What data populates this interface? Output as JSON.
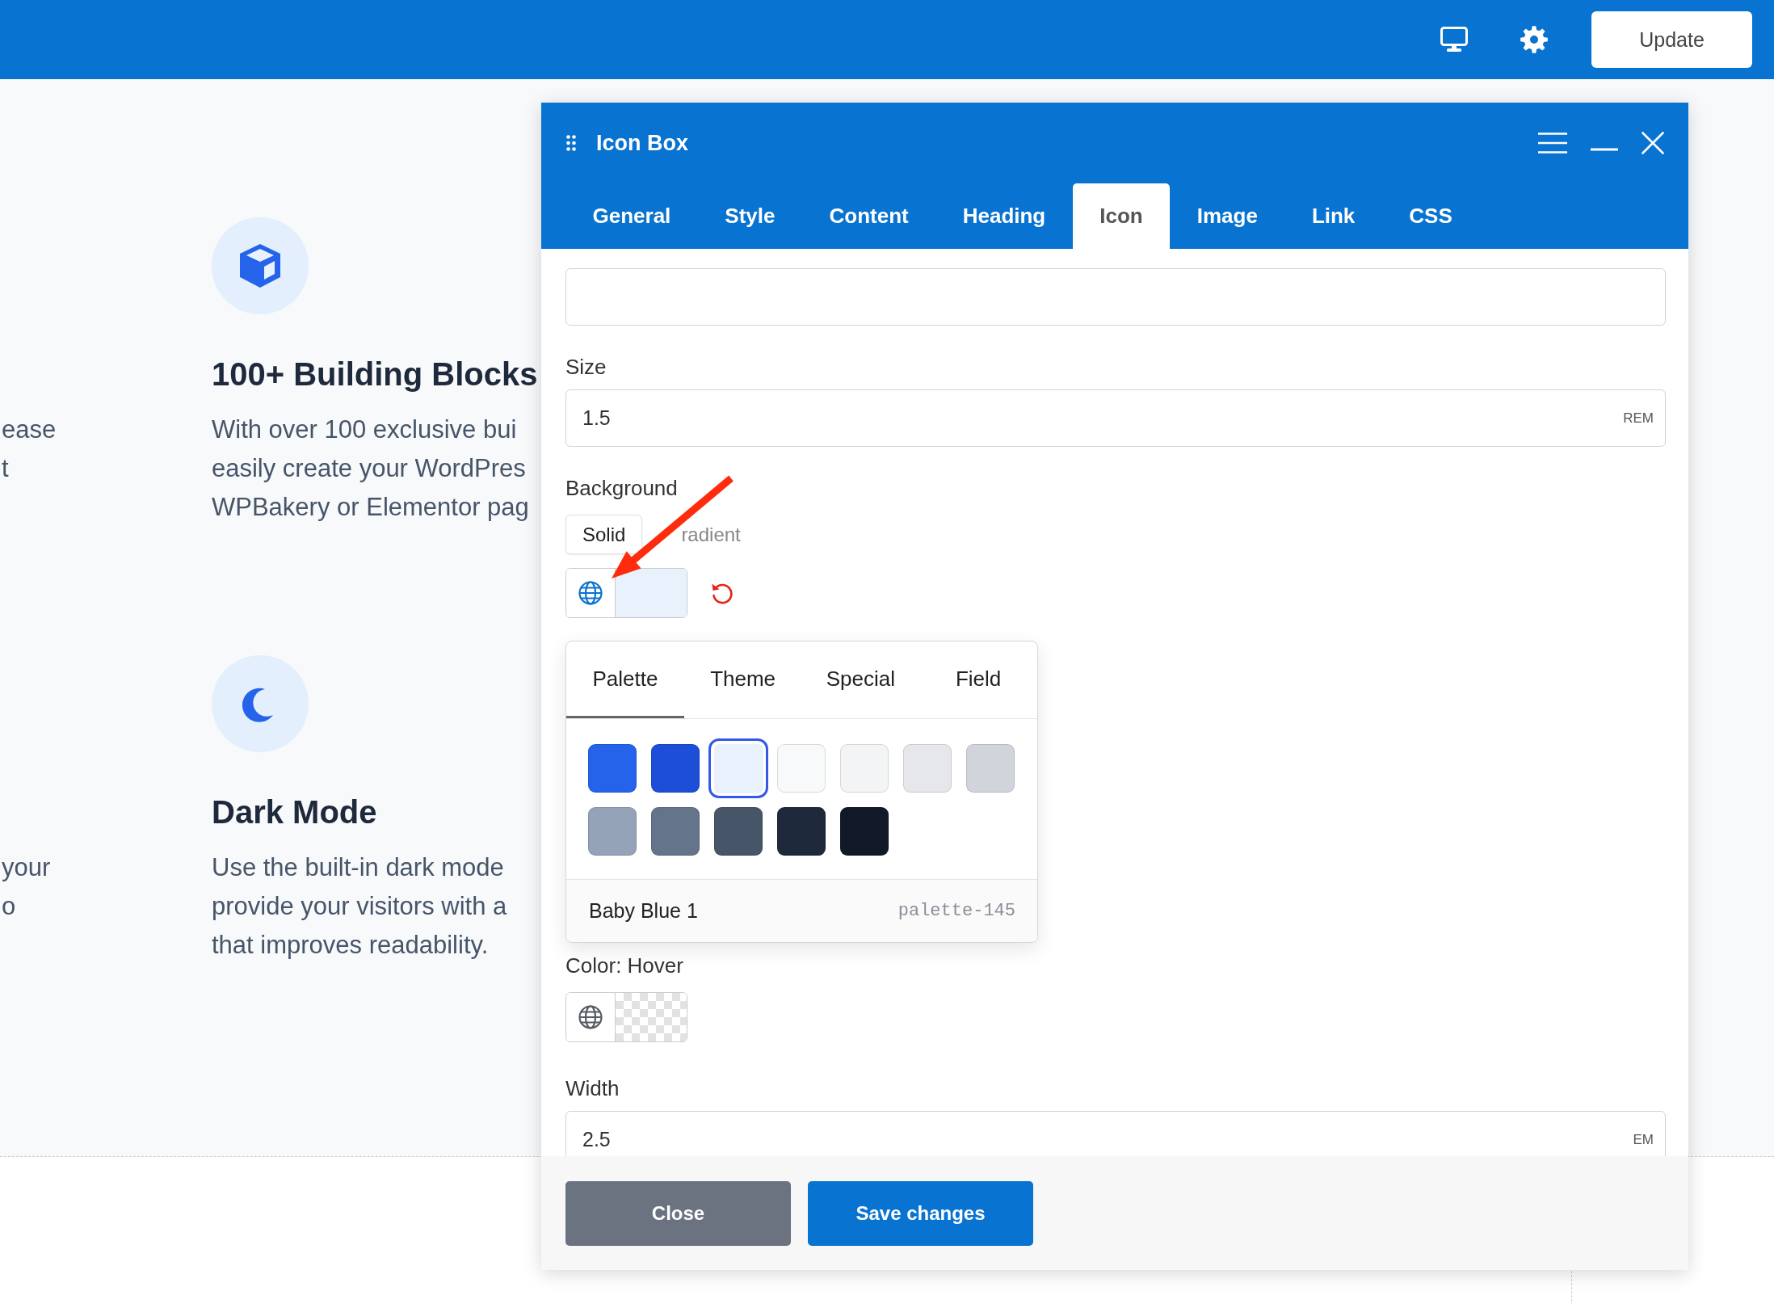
{
  "top_bar": {
    "update_button": "Update"
  },
  "left_column": [
    {
      "lines": [
        "ease",
        "t"
      ]
    },
    {
      "lines": [
        "your",
        "o"
      ]
    }
  ],
  "features": [
    {
      "kind": "cube",
      "title": "100+ Building Blocks",
      "lines": [
        "With over 100 exclusive bui",
        "easily create your WordPres",
        "WPBakery or Elementor pag"
      ]
    },
    {
      "kind": "moon",
      "title": "Dark Mode",
      "lines": [
        "Use the built-in dark mode",
        "provide your visitors with a",
        "that improves readability."
      ]
    }
  ],
  "dialog": {
    "title": "Icon Box",
    "tabs": [
      {
        "label": "General",
        "selected": false
      },
      {
        "label": "Style",
        "selected": false
      },
      {
        "label": "Content",
        "selected": false
      },
      {
        "label": "Heading",
        "selected": false
      },
      {
        "label": "Icon",
        "selected": true
      },
      {
        "label": "Image",
        "selected": false
      },
      {
        "label": "Link",
        "selected": false
      },
      {
        "label": "CSS",
        "selected": false
      }
    ],
    "fields": [
      {
        "kind": "text"
      },
      {
        "kind": "unit",
        "label": "Size",
        "value": "1.5",
        "unit": "REM"
      },
      {
        "kind": "color",
        "label": "Background",
        "modes": [
          {
            "label": "Solid",
            "selected": true
          },
          {
            "label": "radient",
            "selected": false
          }
        ],
        "global": true
      },
      {
        "kind": "palette",
        "tabs": [
          {
            "label": "Palette",
            "selected": true
          },
          {
            "label": "Theme",
            "selected": false
          },
          {
            "label": "Special",
            "selected": false
          },
          {
            "label": "Field",
            "selected": false
          }
        ],
        "swatches": [
          {
            "color": "#2563eb",
            "selected": false
          },
          {
            "color": "#1d4ed8",
            "selected": false
          },
          {
            "color": "#e8f1fc",
            "selected": true
          },
          {
            "color": "#f8f9fa",
            "selected": false
          },
          {
            "color": "#f3f4f6",
            "selected": false
          },
          {
            "color": "#e5e7eb",
            "selected": false
          },
          {
            "color": "#d1d5db",
            "selected": false
          },
          {
            "color": "#94a3b8",
            "selected": false
          },
          {
            "color": "#64748b",
            "selected": false
          },
          {
            "color": "#475569",
            "selected": false
          },
          {
            "color": "#1e293b",
            "selected": false
          },
          {
            "color": "#111827",
            "selected": false
          }
        ],
        "selected_name": "Baby Blue 1",
        "selected_id": "palette-145"
      },
      {
        "kind": "color",
        "label": "Color: Hover",
        "global": false
      },
      {
        "kind": "unit",
        "label": "Width",
        "value": "2.5",
        "unit": "EM"
      }
    ],
    "buttons": [
      {
        "kind": "secondary",
        "label": "Close"
      },
      {
        "kind": "primary",
        "label": "Save changes"
      }
    ]
  }
}
